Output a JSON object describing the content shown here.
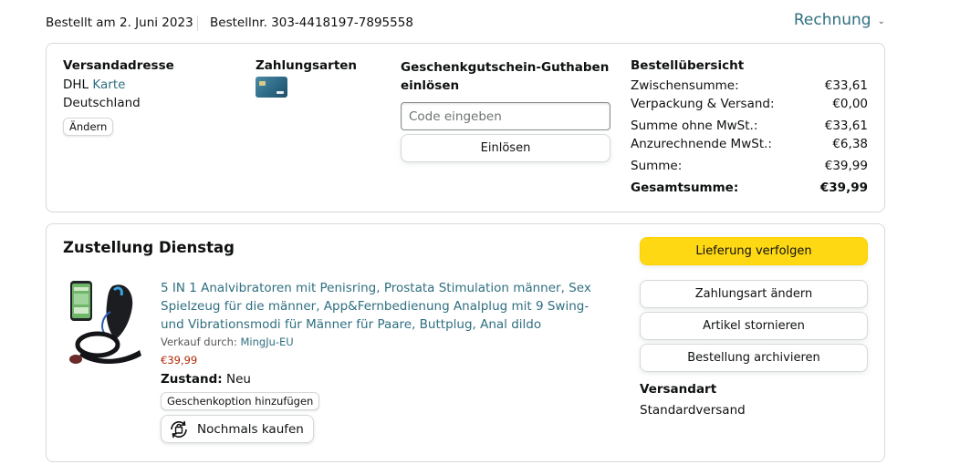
{
  "order": {
    "date_text": "Bestellt am 2. Juni 2023",
    "number_text": "Bestellnr. 303-4418197-7895558",
    "invoice_label": "Rechnung"
  },
  "shipping": {
    "title": "Versandadresse",
    "line1_prefix": "DHL",
    "line1_link": "Karte",
    "line2": "Deutschland",
    "change_label": "Ändern"
  },
  "payment": {
    "title": "Zahlungsarten",
    "card_icon": "credit-card-icon"
  },
  "gift_card": {
    "title": "Geschenkgutschein-Guthaben einlösen",
    "input_placeholder": "Code eingeben",
    "input_value": "",
    "redeem_label": "Einlösen"
  },
  "summary": {
    "title": "Bestellübersicht",
    "rows": [
      {
        "label": "Zwischensumme:",
        "value": "€33,61"
      },
      {
        "label": "Verpackung & Versand:",
        "value": "€0,00"
      },
      {
        "label": "Summe ohne MwSt.:",
        "value": "€33,61"
      },
      {
        "label": "Anzurechnende MwSt.:",
        "value": "€6,38"
      },
      {
        "label": "Summe:",
        "value": "€39,99"
      },
      {
        "label": "Gesamtsumme:",
        "value": "€39,99"
      }
    ]
  },
  "delivery": {
    "title": "Zustellung Dienstag",
    "product": {
      "title": "5 IN 1 Analvibratoren mit Penisring, Prostata Stimulation männer, Sex Spielzeug für die männer, App&Fernbedienung Analplug mit 9 Swing- und Vibrationsmodi für Männer für Paare, Buttplug, Anal dildo",
      "seller_prefix": "Verkauf durch:",
      "seller_name": "MingJu-EU",
      "price": "€39,99",
      "condition_label": "Zustand:",
      "condition_value": "Neu",
      "gift_option_label": "Geschenkoption hinzufügen",
      "buy_again_label": "Nochmals kaufen"
    },
    "actions": {
      "track": "Lieferung verfolgen",
      "change_payment": "Zahlungsart ändern",
      "cancel": "Artikel stornieren",
      "archive": "Bestellung archivieren"
    },
    "shipping_method_title": "Versandart",
    "shipping_method_value": "Standardversand"
  },
  "colors": {
    "link": "#2f6f80",
    "price": "#b12704",
    "primary_button": "#ffd814",
    "border": "#d5d9d9"
  }
}
